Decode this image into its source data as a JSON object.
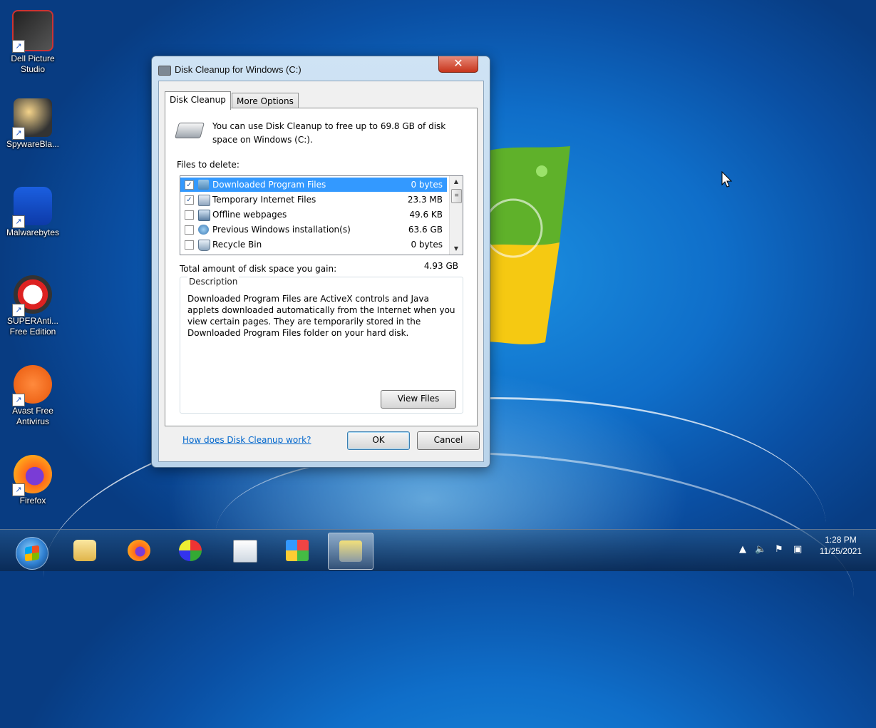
{
  "desktop": {
    "icons": [
      {
        "label": "Dell Picture Studio",
        "icon": "dell-picture-studio-icon"
      },
      {
        "label": "SpywareBla...",
        "icon": "spywareblaster-icon"
      },
      {
        "label": "Malwarebytes",
        "icon": "malwarebytes-icon"
      },
      {
        "label": "SUPERAnti... Free Edition",
        "icon": "superantispyware-icon"
      },
      {
        "label": "Avast Free Antivirus",
        "icon": "avast-icon"
      },
      {
        "label": "Firefox",
        "icon": "firefox-icon"
      }
    ]
  },
  "window": {
    "title": "Disk Cleanup for Windows (C:)",
    "close_label": "✕",
    "tabs": [
      {
        "label": "Disk Cleanup",
        "active": true
      },
      {
        "label": "More Options",
        "active": false
      }
    ],
    "intro": "You can use Disk Cleanup to free up to 69.8 GB of disk space on Windows (C:).",
    "files_label": "Files to delete:",
    "files": [
      {
        "name": "Downloaded Program Files",
        "size": "0 bytes",
        "checked": true,
        "selected": true,
        "icon": "folder-icon"
      },
      {
        "name": "Temporary Internet Files",
        "size": "23.3 MB",
        "checked": true,
        "selected": false,
        "icon": "page-icon"
      },
      {
        "name": "Offline webpages",
        "size": "49.6 KB",
        "checked": false,
        "selected": false,
        "icon": "offline-page-icon"
      },
      {
        "name": "Previous Windows installation(s)",
        "size": "63.6 GB",
        "checked": false,
        "selected": false,
        "icon": "windows-installation-icon"
      },
      {
        "name": "Recycle Bin",
        "size": "0 bytes",
        "checked": false,
        "selected": false,
        "icon": "recycle-bin-icon"
      }
    ],
    "total_label": "Total amount of disk space you gain:",
    "total_value": "4.93 GB",
    "description_title": "Description",
    "description_text": "Downloaded Program Files are ActiveX controls and Java applets downloaded automatically from the Internet when you view certain pages. They are temporarily stored in the Downloaded Program Files folder on your hard disk.",
    "view_files_label": "View Files",
    "help_link": "How does Disk Cleanup work?",
    "ok_label": "OK",
    "cancel_label": "Cancel"
  },
  "taskbar": {
    "pinned": [
      "file-explorer-icon",
      "firefox-icon",
      "paint-icon",
      "wordpad-icon",
      "app-icon",
      "disk-cleanup-icon"
    ],
    "tray_icons": [
      "show-hidden-icons-icon",
      "volume-icon",
      "action-center-flag-icon",
      "network-icon"
    ],
    "time": "1:28 PM",
    "date": "11/25/2021"
  },
  "colors": {
    "desktop_blue": "#0f6ec9",
    "selection": "#3399ff",
    "link": "#0066cc",
    "close_red": "#c7341c"
  }
}
